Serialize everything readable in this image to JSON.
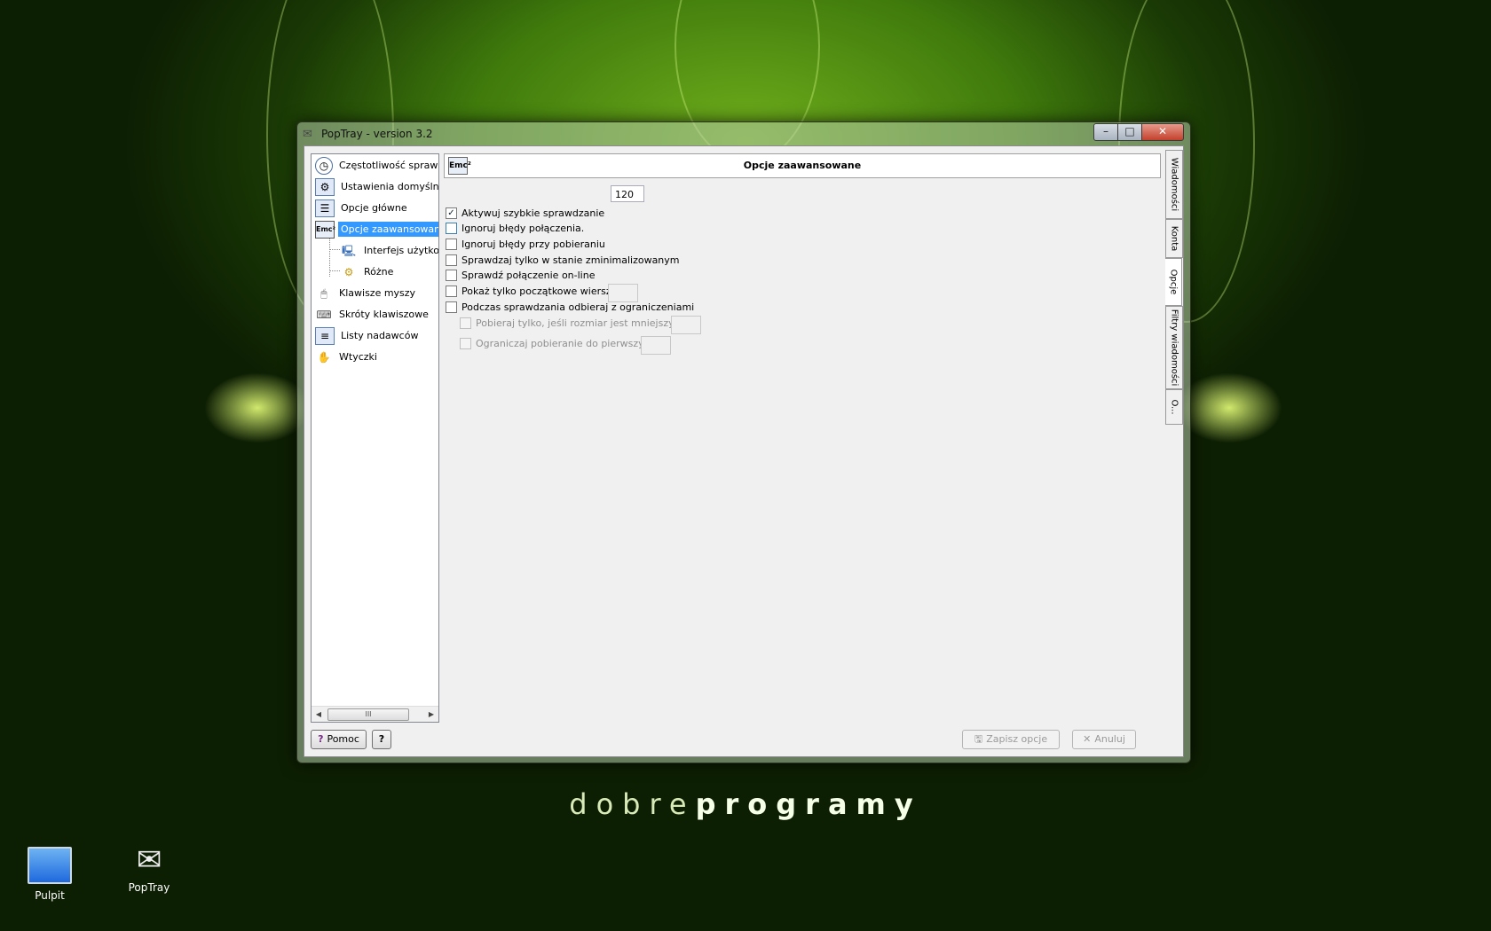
{
  "window": {
    "title": "PopTray - version 3.2",
    "min_label": "–",
    "max_label": "□",
    "close_label": "✕"
  },
  "tree": {
    "items": [
      {
        "label": "Częstotliwość sprawdzania",
        "icon": "clock-icon"
      },
      {
        "label": "Ustawienia domyślne",
        "icon": "settings-page-icon"
      },
      {
        "label": "Opcje główne",
        "icon": "options-page-icon"
      },
      {
        "label": "Opcje zaawansowane",
        "icon": "emc-icon",
        "selected": true
      },
      {
        "label": "Interfejs użytkownika",
        "icon": "computer-icon"
      },
      {
        "label": "Różne",
        "icon": "gears-icon"
      },
      {
        "label": "Klawisze myszy",
        "icon": "mouse-icon"
      },
      {
        "label": "Skróty klawiszowe",
        "icon": "keyboard-icon"
      },
      {
        "label": "Listy nadawców",
        "icon": "list-icon"
      },
      {
        "label": "Wtyczki",
        "icon": "plugin-icon"
      }
    ],
    "scroll_grip": "III"
  },
  "header": {
    "title": "Opcje zaawansowane",
    "icon_text": "Emc²"
  },
  "options": {
    "interval_value": "120",
    "items": [
      {
        "label": "Aktywuj szybkie sprawdzanie",
        "checked": true
      },
      {
        "label": "Ignoruj błędy połączenia.",
        "checked": false
      },
      {
        "label": "Ignoruj błędy przy pobieraniu",
        "checked": false
      },
      {
        "label": "Sprawdzaj tylko w stanie zminimalizowanym",
        "checked": false
      },
      {
        "label": "Sprawdź połączenie on-line",
        "checked": false
      },
      {
        "label": "Pokaż tylko początkowe wiersze",
        "checked": false
      },
      {
        "label": "Podczas sprawdzania odbieraj z ograniczeniami",
        "checked": false
      },
      {
        "label": "Pobieraj tylko, jeśli rozmiar jest mniejszy niż",
        "checked": false,
        "disabled": true
      },
      {
        "label": "Ograniczaj pobieranie do pierwszych",
        "checked": false,
        "disabled": true
      }
    ]
  },
  "tabs": [
    "Wiadomości",
    "Konta",
    "Opcje",
    "Filtry wiadomości",
    "O..."
  ],
  "buttons": {
    "help": "Pomoc",
    "whats_this": "?",
    "save": "Zapisz opcje",
    "cancel": "Anuluj"
  },
  "brand": {
    "light": "dobre",
    "bold": "programy"
  },
  "desktop": {
    "icons": [
      "Pulpit",
      "PopTray"
    ]
  },
  "colors": {
    "selection": "#3399ff",
    "background_green": "#3f7a0c"
  }
}
